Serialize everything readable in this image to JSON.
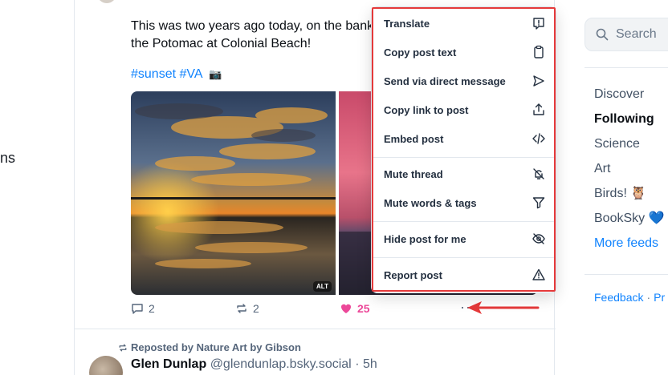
{
  "left_nav": {
    "partial_label": "ns"
  },
  "post": {
    "text": "This was two years ago today, on the bank of the Potomac at Colonial Beach!",
    "hashtags": "#sunset #VA",
    "hashtag_emoji": "📷",
    "image_alt_badge": "ALT",
    "actions": {
      "replies": "2",
      "reposts": "2",
      "likes": "25",
      "more": "···"
    }
  },
  "menu": {
    "items": [
      {
        "label": "Translate",
        "icon": "translate-icon"
      },
      {
        "label": "Copy post text",
        "icon": "clipboard-icon"
      },
      {
        "label": "Send via direct message",
        "icon": "send-icon"
      },
      {
        "label": "Copy link to post",
        "icon": "share-icon"
      },
      {
        "label": "Embed post",
        "icon": "code-icon"
      },
      {
        "label": "Mute thread",
        "icon": "mute-icon"
      },
      {
        "label": "Mute words & tags",
        "icon": "filter-icon"
      },
      {
        "label": "Hide post for me",
        "icon": "eye-slash-icon"
      },
      {
        "label": "Report post",
        "icon": "warning-icon"
      }
    ]
  },
  "next_post": {
    "repost_text": "Reposted by Nature Art by Gibson",
    "author_name": "Glen Dunlap",
    "author_handle": "@glendunlap.bsky.social",
    "time": "5h"
  },
  "sidebar": {
    "search_placeholder": "Search",
    "feeds": [
      {
        "label": "Discover",
        "active": false
      },
      {
        "label": "Following",
        "active": true
      },
      {
        "label": "Science",
        "active": false
      },
      {
        "label": "Art",
        "active": false
      },
      {
        "label": "Birds! 🦉",
        "active": false
      },
      {
        "label": "BookSky 💙",
        "active": false
      }
    ],
    "more_feeds": "More feeds",
    "footer": {
      "feedback": "Feedback",
      "privacy": "Pr"
    }
  },
  "colors": {
    "accent": "#1083fe",
    "like": "#ec4899",
    "highlight": "#e5393a"
  }
}
